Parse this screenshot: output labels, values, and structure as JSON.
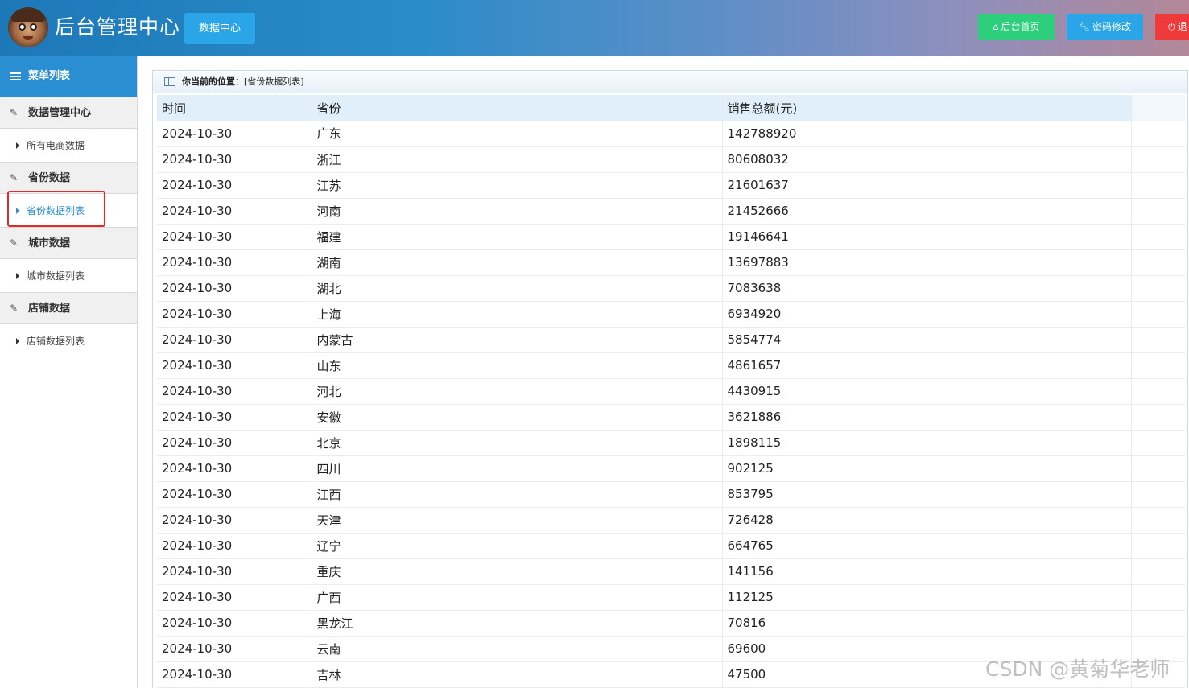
{
  "header": {
    "title": "后台管理中心",
    "nav_button": "数据中心",
    "buttons": [
      {
        "label": "后台首页",
        "icon": "home-icon",
        "color": "#2dcf7c"
      },
      {
        "label": "密码修改",
        "icon": "wrench-icon",
        "color": "#2aa6e8"
      },
      {
        "label": "退",
        "icon": "power-icon",
        "color": "#ee3a3a"
      }
    ]
  },
  "sidebar": {
    "title": "菜单列表",
    "groups": [
      {
        "label": "数据管理中心",
        "items": [
          "所有电商数据"
        ]
      },
      {
        "label": "省份数据",
        "items": [
          "省份数据列表"
        ]
      },
      {
        "label": "城市数据",
        "items": [
          "城市数据列表"
        ]
      },
      {
        "label": "店铺数据",
        "items": [
          "店铺数据列表"
        ]
      }
    ],
    "active_item": "省份数据列表"
  },
  "breadcrumb": {
    "label": "你当前的位置：",
    "path": "[省份数据列表]"
  },
  "table": {
    "columns": [
      "时间",
      "省份",
      "销售总额(元)"
    ],
    "rows": [
      [
        "2024-10-30",
        "广东",
        "142788920"
      ],
      [
        "2024-10-30",
        "浙江",
        "80608032"
      ],
      [
        "2024-10-30",
        "江苏",
        "21601637"
      ],
      [
        "2024-10-30",
        "河南",
        "21452666"
      ],
      [
        "2024-10-30",
        "福建",
        "19146641"
      ],
      [
        "2024-10-30",
        "湖南",
        "13697883"
      ],
      [
        "2024-10-30",
        "湖北",
        "7083638"
      ],
      [
        "2024-10-30",
        "上海",
        "6934920"
      ],
      [
        "2024-10-30",
        "内蒙古",
        "5854774"
      ],
      [
        "2024-10-30",
        "山东",
        "4861657"
      ],
      [
        "2024-10-30",
        "河北",
        "4430915"
      ],
      [
        "2024-10-30",
        "安徽",
        "3621886"
      ],
      [
        "2024-10-30",
        "北京",
        "1898115"
      ],
      [
        "2024-10-30",
        "四川",
        "902125"
      ],
      [
        "2024-10-30",
        "江西",
        "853795"
      ],
      [
        "2024-10-30",
        "天津",
        "726428"
      ],
      [
        "2024-10-30",
        "辽宁",
        "664765"
      ],
      [
        "2024-10-30",
        "重庆",
        "141156"
      ],
      [
        "2024-10-30",
        "广西",
        "112125"
      ],
      [
        "2024-10-30",
        "黑龙江",
        "70816"
      ],
      [
        "2024-10-30",
        "云南",
        "69600"
      ],
      [
        "2024-10-30",
        "吉林",
        "47500"
      ]
    ]
  },
  "watermark": "CSDN @黄菊华老师"
}
